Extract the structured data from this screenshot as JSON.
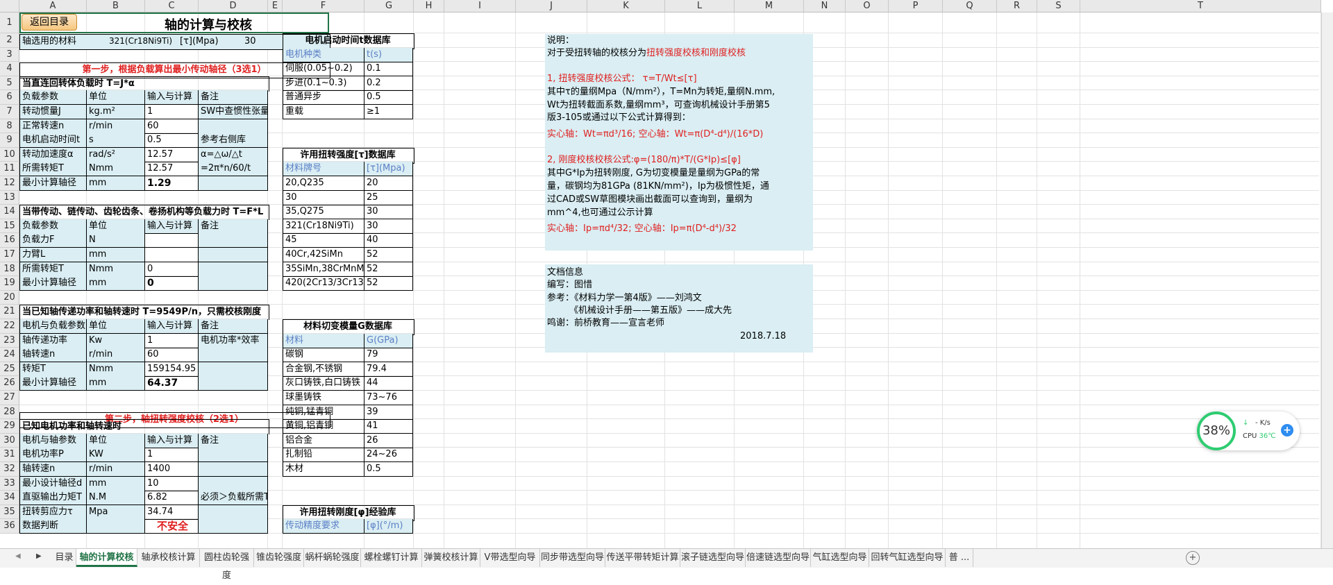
{
  "columns": [
    "A",
    "B",
    "C",
    "D",
    "E",
    "F",
    "G",
    "H",
    "I",
    "J",
    "K",
    "L",
    "M",
    "N",
    "O",
    "P",
    "Q",
    "R",
    "S",
    "T"
  ],
  "rows": [
    "1",
    "2",
    "3",
    "4",
    "5",
    "6",
    "7",
    "8",
    "9",
    "10",
    "11",
    "12",
    "13",
    "14",
    "15",
    "16",
    "17",
    "18",
    "19",
    "20",
    "21",
    "22",
    "23",
    "24",
    "25",
    "26",
    "27",
    "28",
    "29",
    "30",
    "31",
    "32",
    "33",
    "34",
    "35",
    "36"
  ],
  "back_button": "返回目录",
  "title": "轴的计算与校核",
  "r2": {
    "a": "轴选用的材料",
    "b": "321(Cr18Ni9Ti)",
    "c": "[τ](Mpa)",
    "d": "30"
  },
  "step1": "第一步，根据负载算出最小传动轴径（3选1）",
  "sec1": {
    "title": "当直连回转体负载时 T=J*α",
    "rows": [
      [
        "负载参数",
        "单位",
        "输入与计算",
        "备注"
      ],
      [
        "转动惯量J",
        "kg.m²",
        "1",
        "SW中查惯性张量"
      ],
      [
        "正常转速n",
        "r/min",
        "60",
        ""
      ],
      [
        "电机启动时间t",
        "s",
        "0.5",
        "参考右侧库"
      ],
      [
        "转动加速度α",
        "rad/s²",
        "12.57",
        "α=△ω/△t"
      ],
      [
        "所需转矩T",
        "Nmm",
        "12.57",
        "=2π*n/60/t"
      ],
      [
        "最小计算轴径",
        "mm",
        "1.29",
        ""
      ]
    ]
  },
  "sec2": {
    "title": "当带传动、链传动、齿轮齿条、卷扬机构等负载力时 T=F*L",
    "rows": [
      [
        "负载参数",
        "单位",
        "输入与计算",
        "备注"
      ],
      [
        "负载力F",
        "N",
        "",
        ""
      ],
      [
        "力臂L",
        "mm",
        "",
        ""
      ],
      [
        "所需转矩T",
        "Nmm",
        "0",
        ""
      ],
      [
        "最小计算轴径",
        "mm",
        "0",
        ""
      ]
    ]
  },
  "sec3": {
    "title": "当已知轴传递功率和轴转速时 T=9549P/n，只需校核刚度",
    "rows": [
      [
        "电机与负载参数",
        "单位",
        "输入与计算",
        "备注"
      ],
      [
        "轴传递功率",
        "Kw",
        "1",
        "电机功率*效率"
      ],
      [
        "轴转速n",
        "r/min",
        "60",
        ""
      ],
      [
        "转矩T",
        "Nmm",
        "159154.95",
        ""
      ],
      [
        "最小计算轴径",
        "mm",
        "64.37",
        ""
      ]
    ]
  },
  "step2": "第二步，轴扭转强度校核（2选1）",
  "sec4": {
    "title": "已知电机功率和轴转速时",
    "rows": [
      [
        "电机与轴参数",
        "单位",
        "输入与计算",
        "备注"
      ],
      [
        "电机功率P",
        "KW",
        "1",
        ""
      ],
      [
        "轴转速n",
        "r/min",
        "1400",
        ""
      ],
      [
        "最小设计轴径d",
        "mm",
        "10",
        ""
      ],
      [
        "直驱输出力矩T",
        "N.M",
        "6.82",
        "必须＞负载所需T"
      ],
      [
        "扭转剪应力τ",
        "Mpa",
        "34.74",
        ""
      ],
      [
        "数据判断",
        "",
        "不安全",
        ""
      ]
    ]
  },
  "db1": {
    "title": "电机启动时间t数据库",
    "header": [
      "电机种类",
      "t(s)"
    ],
    "rows": [
      [
        "伺服(0.05~0.2)",
        "0.1"
      ],
      [
        "步进(0.1~0.3)",
        "0.2"
      ],
      [
        "普通异步",
        "0.5"
      ],
      [
        "重载",
        "≥1"
      ]
    ]
  },
  "db2": {
    "title": "许用扭转强度[τ]数据库",
    "header": [
      "材料牌号",
      "[τ](Mpa)"
    ],
    "rows": [
      [
        "20,Q235",
        "20"
      ],
      [
        "30",
        "25"
      ],
      [
        "35,Q275",
        "30"
      ],
      [
        "321(Cr18Ni9Ti)",
        "30"
      ],
      [
        "45",
        "40"
      ],
      [
        "40Cr,42SiMn",
        "52"
      ],
      [
        "35SiMn,38CrMnMo",
        "52"
      ],
      [
        "420(2Cr13/3Cr13)",
        "52"
      ]
    ]
  },
  "db3": {
    "title": "材料切变模量G数据库",
    "header": [
      "材料",
      "G(GPa)"
    ],
    "rows": [
      [
        "碳钢",
        "79"
      ],
      [
        "合金钢,不锈钢",
        "79.4"
      ],
      [
        "灰口铸铁,白口铸铁",
        "44"
      ],
      [
        "球墨铸铁",
        "73~76"
      ],
      [
        "纯铜,锰青铜",
        "39"
      ],
      [
        "黄铜,铝青铜",
        "41"
      ],
      [
        "铝合金",
        "26"
      ],
      [
        "扎制铅",
        "24~26"
      ],
      [
        "木材",
        "0.5"
      ]
    ]
  },
  "db4": {
    "title": "许用扭转刚度[φ]经验库",
    "header": [
      "传动精度要求",
      "[φ](°/m)"
    ]
  },
  "notes": {
    "l1": "说明：",
    "l2a": "对于受扭转轴的校核分为",
    "l2b": "扭转强度校核和刚度校核",
    "l3": "1, 扭转强度校核公式： τ=T/Wt≤[τ]",
    "l4": "其中τ的量纲Mpa（N/mm²），T=Mn为转矩,量纲N.mm,",
    "l5": "Wt为扭转截面系数,量纲mm³，可查询机械设计手册第5",
    "l6": "版3-105或通过以下公式计算得到：",
    "l7": "实心轴：Wt=πd³/16; 空心轴：Wt=π(D⁴-d⁴)/(16*D)",
    "l8": "2, 刚度校核校核公式:φ=(180/π)*T/(G*Ip)≤[φ]",
    "l9": "其中G*Ip为扭转刚度, G为切变模量是量纲为GPa的常",
    "l10": "量，碳钢均为81GPa (81KN/mm²)，Ip为极惯性矩，通",
    "l11": "过CAD或SW草图模块画出截面可以查询到，量纲为",
    "l12": "mm^4,也可通过公示计算",
    "l13": "实心轴：Ip=πd⁴/32; 空心轴：Ip=π(D⁴-d⁴)/32"
  },
  "docinfo": {
    "l1": "文档信息",
    "l2": "编写：图惜",
    "l3": "参考：《材料力学一第4版》——刘鸿文",
    "l4": "《机械设计手册——第五版》——成大先",
    "l5": "鸣谢：前桥教育——宣言老师",
    "date": "2018.7.18"
  },
  "widget": {
    "percent": "38%",
    "speed": "- K/s",
    "cpu_label": "CPU",
    "cpu_temp": "36℃",
    "accent": "#2ecc71"
  },
  "tabs": [
    "目录",
    "轴的计算校核",
    "轴承校核计算",
    "圆柱齿轮强度",
    "锥齿轮强度",
    "蜗杆蜗轮强度",
    "螺栓螺钉计算",
    "弹簧校核计算",
    "V带选型向导",
    "同步带选型向导",
    "传送平带转矩计算",
    "滚子链选型向导",
    "倍速链选型向导",
    "气缸选型向导",
    "回转气缸选型向导",
    "普 ..."
  ],
  "active_tab": "轴的计算校核",
  "colors": {
    "accent_green": "#217346",
    "cell_blue": "#daeef3",
    "red": "#e02020",
    "header_blue": "#5b7fc6"
  }
}
